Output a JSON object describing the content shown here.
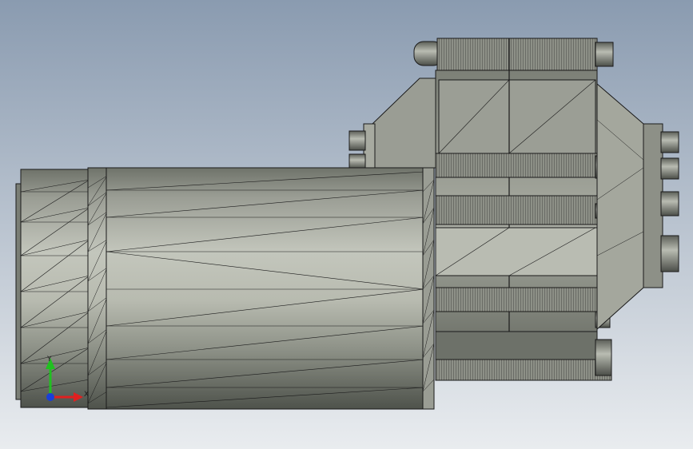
{
  "viewport": {
    "background_top": "#8a9bb0",
    "background_bottom": "#e9ecef"
  },
  "model": {
    "face_light": "#b4b7ad",
    "face_mid": "#8f9389",
    "face_dark": "#5c6058",
    "edge_color": "#1a1a1a"
  },
  "triad": {
    "x_label": "X",
    "y_label": "Y",
    "x_color": "#e02020",
    "y_color": "#20c020",
    "z_color": "#1a3fd8"
  }
}
